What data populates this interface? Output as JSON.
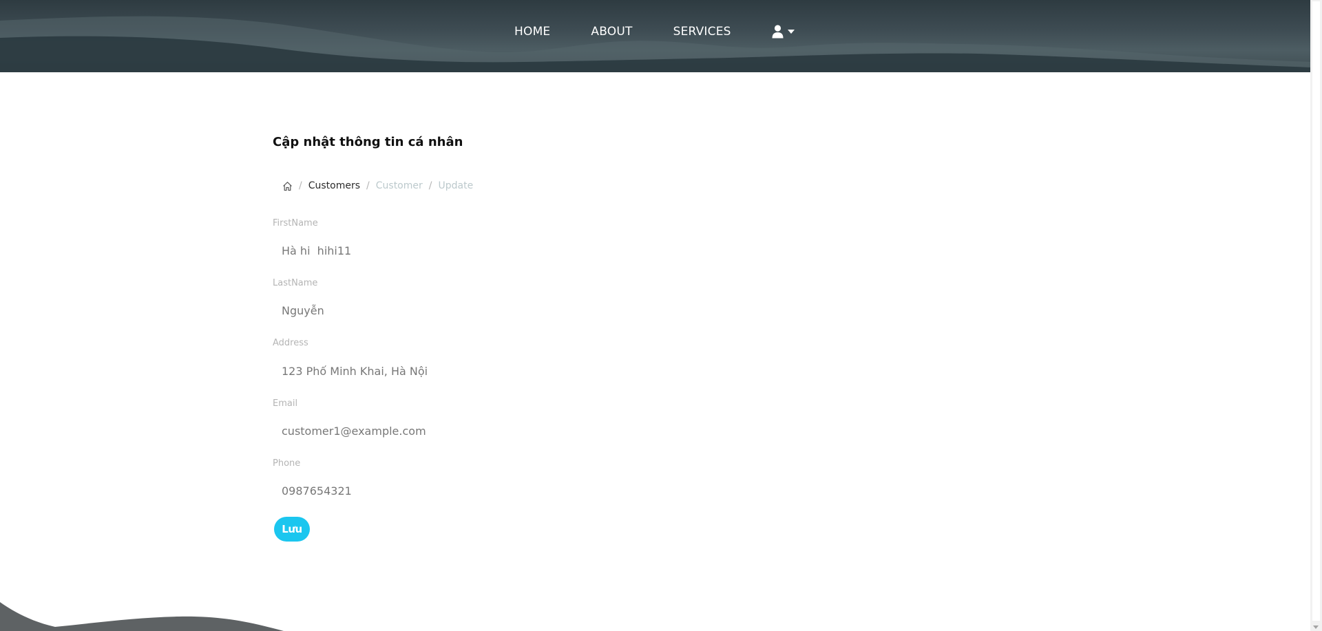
{
  "nav": {
    "home": "HOME",
    "about": "ABOUT",
    "services": "SERVICES",
    "user_icon": "user-icon",
    "caret_icon": "caret-down-icon"
  },
  "page": {
    "title": "Cập nhật thông tin cá nhân"
  },
  "breadcrumb": {
    "home_icon": "home-icon",
    "items": [
      "Customers",
      "Customer",
      "Update"
    ],
    "separator": "/"
  },
  "form": {
    "firstname": {
      "label": "FirstName",
      "value": "Hà hi  hihi11"
    },
    "lastname": {
      "label": "LastName",
      "value": "Nguyễn"
    },
    "address": {
      "label": "Address",
      "value": "123 Phố Minh Khai, Hà Nội"
    },
    "email": {
      "label": "Email",
      "value": "customer1@example.com"
    },
    "phone": {
      "label": "Phone",
      "value": "0987654321"
    },
    "save_label": "Lưu"
  },
  "colors": {
    "accent": "#1bc6ef",
    "header_bg": "#3d4b52",
    "footer_wave": "#5e6264"
  }
}
